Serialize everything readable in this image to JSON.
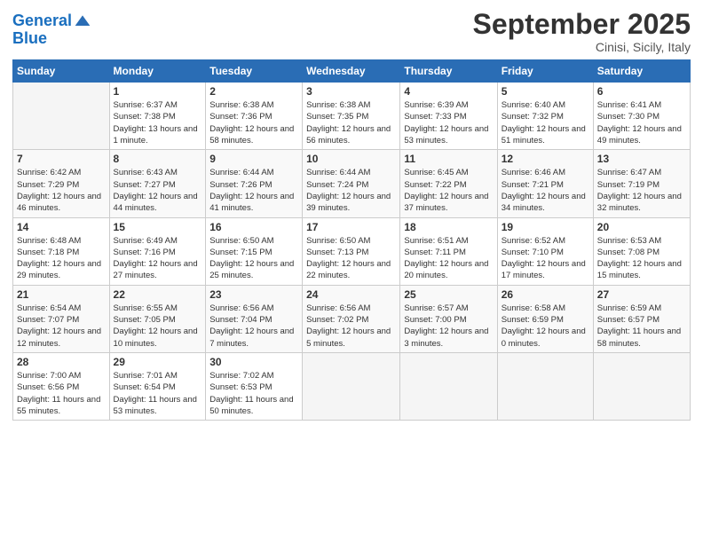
{
  "header": {
    "logo_general": "General",
    "logo_blue": "Blue",
    "month_title": "September 2025",
    "location": "Cinisi, Sicily, Italy"
  },
  "weekdays": [
    "Sunday",
    "Monday",
    "Tuesday",
    "Wednesday",
    "Thursday",
    "Friday",
    "Saturday"
  ],
  "weeks": [
    [
      {
        "day": "",
        "sunrise": "",
        "sunset": "",
        "daylight": ""
      },
      {
        "day": "1",
        "sunrise": "Sunrise: 6:37 AM",
        "sunset": "Sunset: 7:38 PM",
        "daylight": "Daylight: 13 hours and 1 minute."
      },
      {
        "day": "2",
        "sunrise": "Sunrise: 6:38 AM",
        "sunset": "Sunset: 7:36 PM",
        "daylight": "Daylight: 12 hours and 58 minutes."
      },
      {
        "day": "3",
        "sunrise": "Sunrise: 6:38 AM",
        "sunset": "Sunset: 7:35 PM",
        "daylight": "Daylight: 12 hours and 56 minutes."
      },
      {
        "day": "4",
        "sunrise": "Sunrise: 6:39 AM",
        "sunset": "Sunset: 7:33 PM",
        "daylight": "Daylight: 12 hours and 53 minutes."
      },
      {
        "day": "5",
        "sunrise": "Sunrise: 6:40 AM",
        "sunset": "Sunset: 7:32 PM",
        "daylight": "Daylight: 12 hours and 51 minutes."
      },
      {
        "day": "6",
        "sunrise": "Sunrise: 6:41 AM",
        "sunset": "Sunset: 7:30 PM",
        "daylight": "Daylight: 12 hours and 49 minutes."
      }
    ],
    [
      {
        "day": "7",
        "sunrise": "Sunrise: 6:42 AM",
        "sunset": "Sunset: 7:29 PM",
        "daylight": "Daylight: 12 hours and 46 minutes."
      },
      {
        "day": "8",
        "sunrise": "Sunrise: 6:43 AM",
        "sunset": "Sunset: 7:27 PM",
        "daylight": "Daylight: 12 hours and 44 minutes."
      },
      {
        "day": "9",
        "sunrise": "Sunrise: 6:44 AM",
        "sunset": "Sunset: 7:26 PM",
        "daylight": "Daylight: 12 hours and 41 minutes."
      },
      {
        "day": "10",
        "sunrise": "Sunrise: 6:44 AM",
        "sunset": "Sunset: 7:24 PM",
        "daylight": "Daylight: 12 hours and 39 minutes."
      },
      {
        "day": "11",
        "sunrise": "Sunrise: 6:45 AM",
        "sunset": "Sunset: 7:22 PM",
        "daylight": "Daylight: 12 hours and 37 minutes."
      },
      {
        "day": "12",
        "sunrise": "Sunrise: 6:46 AM",
        "sunset": "Sunset: 7:21 PM",
        "daylight": "Daylight: 12 hours and 34 minutes."
      },
      {
        "day": "13",
        "sunrise": "Sunrise: 6:47 AM",
        "sunset": "Sunset: 7:19 PM",
        "daylight": "Daylight: 12 hours and 32 minutes."
      }
    ],
    [
      {
        "day": "14",
        "sunrise": "Sunrise: 6:48 AM",
        "sunset": "Sunset: 7:18 PM",
        "daylight": "Daylight: 12 hours and 29 minutes."
      },
      {
        "day": "15",
        "sunrise": "Sunrise: 6:49 AM",
        "sunset": "Sunset: 7:16 PM",
        "daylight": "Daylight: 12 hours and 27 minutes."
      },
      {
        "day": "16",
        "sunrise": "Sunrise: 6:50 AM",
        "sunset": "Sunset: 7:15 PM",
        "daylight": "Daylight: 12 hours and 25 minutes."
      },
      {
        "day": "17",
        "sunrise": "Sunrise: 6:50 AM",
        "sunset": "Sunset: 7:13 PM",
        "daylight": "Daylight: 12 hours and 22 minutes."
      },
      {
        "day": "18",
        "sunrise": "Sunrise: 6:51 AM",
        "sunset": "Sunset: 7:11 PM",
        "daylight": "Daylight: 12 hours and 20 minutes."
      },
      {
        "day": "19",
        "sunrise": "Sunrise: 6:52 AM",
        "sunset": "Sunset: 7:10 PM",
        "daylight": "Daylight: 12 hours and 17 minutes."
      },
      {
        "day": "20",
        "sunrise": "Sunrise: 6:53 AM",
        "sunset": "Sunset: 7:08 PM",
        "daylight": "Daylight: 12 hours and 15 minutes."
      }
    ],
    [
      {
        "day": "21",
        "sunrise": "Sunrise: 6:54 AM",
        "sunset": "Sunset: 7:07 PM",
        "daylight": "Daylight: 12 hours and 12 minutes."
      },
      {
        "day": "22",
        "sunrise": "Sunrise: 6:55 AM",
        "sunset": "Sunset: 7:05 PM",
        "daylight": "Daylight: 12 hours and 10 minutes."
      },
      {
        "day": "23",
        "sunrise": "Sunrise: 6:56 AM",
        "sunset": "Sunset: 7:04 PM",
        "daylight": "Daylight: 12 hours and 7 minutes."
      },
      {
        "day": "24",
        "sunrise": "Sunrise: 6:56 AM",
        "sunset": "Sunset: 7:02 PM",
        "daylight": "Daylight: 12 hours and 5 minutes."
      },
      {
        "day": "25",
        "sunrise": "Sunrise: 6:57 AM",
        "sunset": "Sunset: 7:00 PM",
        "daylight": "Daylight: 12 hours and 3 minutes."
      },
      {
        "day": "26",
        "sunrise": "Sunrise: 6:58 AM",
        "sunset": "Sunset: 6:59 PM",
        "daylight": "Daylight: 12 hours and 0 minutes."
      },
      {
        "day": "27",
        "sunrise": "Sunrise: 6:59 AM",
        "sunset": "Sunset: 6:57 PM",
        "daylight": "Daylight: 11 hours and 58 minutes."
      }
    ],
    [
      {
        "day": "28",
        "sunrise": "Sunrise: 7:00 AM",
        "sunset": "Sunset: 6:56 PM",
        "daylight": "Daylight: 11 hours and 55 minutes."
      },
      {
        "day": "29",
        "sunrise": "Sunrise: 7:01 AM",
        "sunset": "Sunset: 6:54 PM",
        "daylight": "Daylight: 11 hours and 53 minutes."
      },
      {
        "day": "30",
        "sunrise": "Sunrise: 7:02 AM",
        "sunset": "Sunset: 6:53 PM",
        "daylight": "Daylight: 11 hours and 50 minutes."
      },
      {
        "day": "",
        "sunrise": "",
        "sunset": "",
        "daylight": ""
      },
      {
        "day": "",
        "sunrise": "",
        "sunset": "",
        "daylight": ""
      },
      {
        "day": "",
        "sunrise": "",
        "sunset": "",
        "daylight": ""
      },
      {
        "day": "",
        "sunrise": "",
        "sunset": "",
        "daylight": ""
      }
    ]
  ]
}
